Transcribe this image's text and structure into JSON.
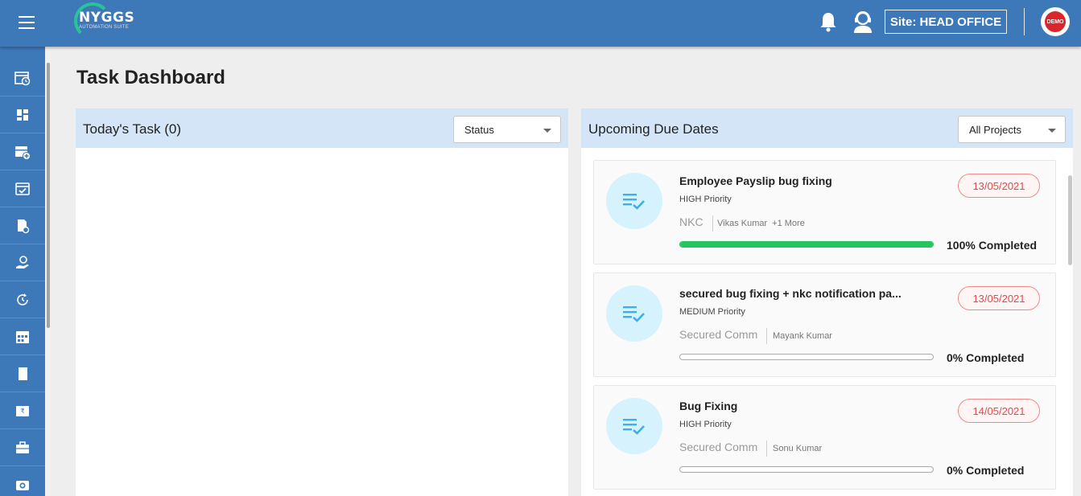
{
  "header": {
    "logo_text": "NYGGS",
    "logo_subtitle": "AUTOMATION SUITE",
    "site_label": "Site: HEAD OFFICE",
    "avatar_text": "DEMO"
  },
  "sidebar": {
    "items": [
      {
        "icon": "calendar-clock-icon"
      },
      {
        "icon": "dashboard-icon"
      },
      {
        "icon": "calendar-add-icon"
      },
      {
        "icon": "calendar-check-icon"
      },
      {
        "icon": "document-settings-icon"
      },
      {
        "icon": "hand-money-icon"
      },
      {
        "icon": "clock-refresh-icon"
      },
      {
        "icon": "calendar-grid-icon"
      },
      {
        "icon": "document-icon"
      },
      {
        "icon": "rupee-tray-icon"
      },
      {
        "icon": "briefcase-icon"
      },
      {
        "icon": "camera-icon"
      }
    ]
  },
  "page": {
    "title": "Task Dashboard"
  },
  "today_panel": {
    "title": "Today's Task (0)",
    "status_select": "Status"
  },
  "upcoming_panel": {
    "title": "Upcoming Due Dates",
    "project_select": "All Projects",
    "tasks": [
      {
        "title": "Employee Payslip bug fixing",
        "priority": "HIGH Priority",
        "project": "NKC",
        "assignee": "Vikas Kumar",
        "more": "+1 More",
        "date": "13/05/2021",
        "progress": 100,
        "progress_label": "100% Completed"
      },
      {
        "title": "secured bug fixing + nkc notification pa...",
        "priority": "MEDIUM Priority",
        "project": "Secured Comm",
        "assignee": "Mayank Kumar",
        "more": "",
        "date": "13/05/2021",
        "progress": 0,
        "progress_label": "0% Completed"
      },
      {
        "title": "Bug Fixing",
        "priority": "HIGH Priority",
        "project": "Secured Comm",
        "assignee": "Sonu Kumar",
        "more": "",
        "date": "14/05/2021",
        "progress": 0,
        "progress_label": "0% Completed"
      }
    ]
  },
  "colors": {
    "brand": "#3d78b8",
    "panel_header": "#d4e5f7",
    "progress": "#22c55e",
    "date_red": "#e14a4a",
    "icon_circle": "#d5f2fd",
    "icon_blue": "#3bb0ea"
  }
}
